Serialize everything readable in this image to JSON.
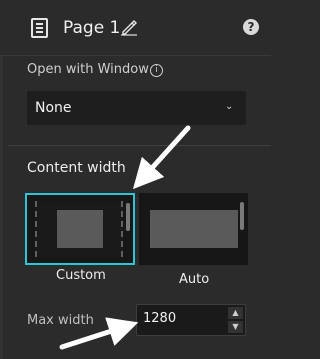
{
  "header": {
    "title": "Page 1",
    "page_icon": "page-icon",
    "edit_icon": "pencil-icon",
    "help_icon": "help-icon",
    "help_glyph": "?"
  },
  "window_section": {
    "label": "Open with Window",
    "info_icon": "info-icon",
    "info_glyph": "i",
    "dropdown_value": "None",
    "chevron": "chevron-down-icon",
    "chevron_glyph": "⌄"
  },
  "content_width": {
    "label": "Content width",
    "options": [
      {
        "label": "Custom",
        "selected": true
      },
      {
        "label": "Auto",
        "selected": false
      }
    ]
  },
  "max_width": {
    "label": "Max width",
    "value": "1280",
    "up_glyph": "▲",
    "down_glyph": "▼"
  },
  "colors": {
    "background": "#2b2b2b",
    "selected_border": "#2ec4d6",
    "text": "#e6e6e6",
    "annotation_arrow": "#ffffff"
  }
}
